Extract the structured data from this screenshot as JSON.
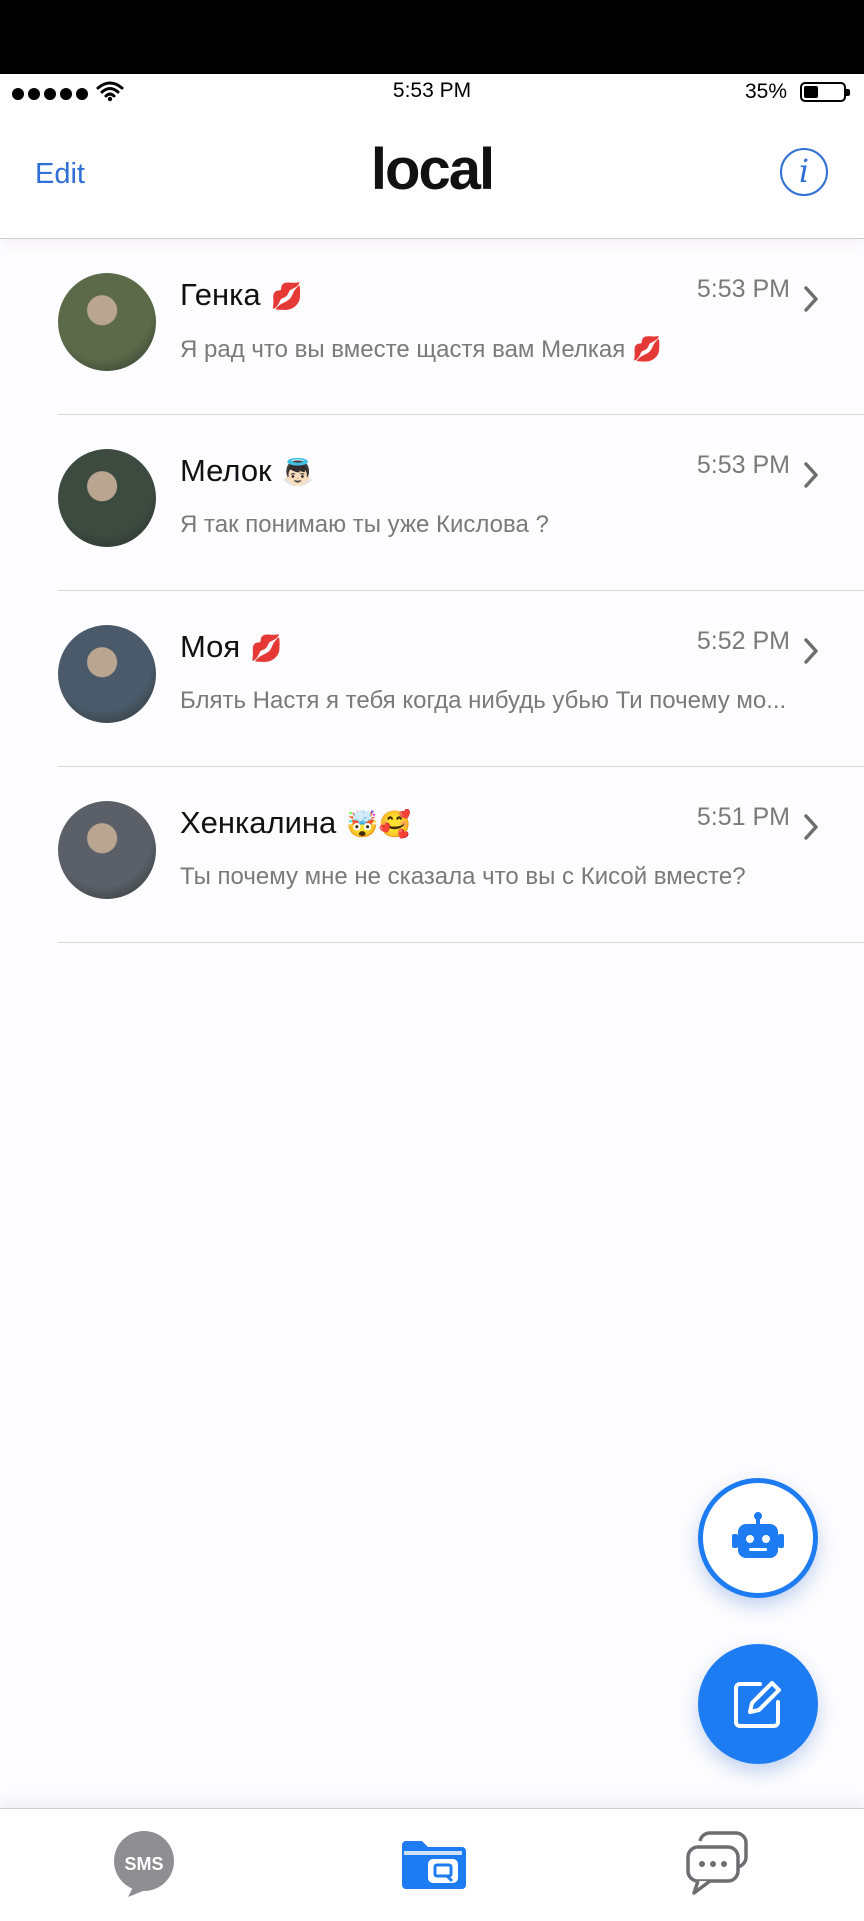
{
  "status": {
    "time": "5:53 PM",
    "battery": "35%"
  },
  "nav": {
    "edit_label": "Edit",
    "title": "local",
    "info_icon": "info-icon"
  },
  "conversations": [
    {
      "name": "Генка",
      "emoji": "💋",
      "time": "5:53 PM",
      "preview": "Я рад что вы вместе щастя вам Мелкая 💋",
      "avatar_color": "#5c6a4a"
    },
    {
      "name": "Мелок",
      "emoji": "👼🏻",
      "time": "5:53 PM",
      "preview": "Я так понимаю ты уже Кислова ?",
      "avatar_color": "#3c4a40"
    },
    {
      "name": "Моя",
      "emoji": "💋",
      "time": "5:52 PM",
      "preview": "Блять Настя я тебя когда нибудь убью Ти почему мо...",
      "avatar_color": "#4a5a6a"
    },
    {
      "name": "Хенкалина",
      "emoji": "🤯🥰",
      "time": "5:51 PM",
      "preview": "Ты почему мне не сказала что вы с Кисой вместе?",
      "avatar_color": "#5a5f68"
    }
  ],
  "fabs": {
    "bot_icon": "robot-icon",
    "compose_icon": "compose-icon"
  },
  "tabs": {
    "sms_label": "SMS",
    "local_icon": "local-folder-icon",
    "chat_icon": "chat-bubbles-icon"
  },
  "colors": {
    "accent": "#1e7cf2",
    "link": "#2f6fd6",
    "secondary_text": "#7a7a7e"
  }
}
